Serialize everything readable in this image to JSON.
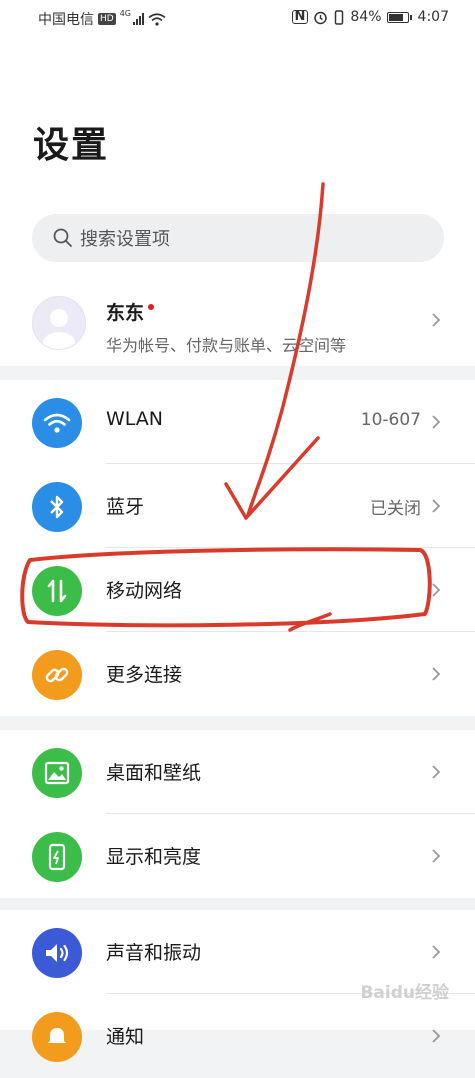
{
  "status_bar": {
    "carrier": "中国电信",
    "hd": "HD",
    "network": "4G",
    "battery": "84%",
    "battery_level": 0.84,
    "time": "4:07"
  },
  "page": {
    "title": "设置"
  },
  "search": {
    "placeholder": "搜索设置项"
  },
  "account": {
    "name": "东东",
    "subtitle": "华为帐号、付款与账单、云空间等"
  },
  "items": [
    {
      "label": "WLAN",
      "value": "10-607",
      "icon": "wifi-icon",
      "color": "#2a8de6"
    },
    {
      "label": "蓝牙",
      "value": "已关闭",
      "icon": "bluetooth-icon",
      "color": "#2a8de6"
    },
    {
      "label": "移动网络",
      "value": "",
      "icon": "mobile-data-icon",
      "color": "#3cbd4a"
    },
    {
      "label": "更多连接",
      "value": "",
      "icon": "link-icon",
      "color": "#f39b1c"
    },
    {
      "label": "桌面和壁纸",
      "value": "",
      "icon": "wallpaper-icon",
      "color": "#3cbd4a"
    },
    {
      "label": "显示和亮度",
      "value": "",
      "icon": "display-icon",
      "color": "#3cbd4a"
    },
    {
      "label": "声音和振动",
      "value": "",
      "icon": "sound-icon",
      "color": "#3d5ad6"
    },
    {
      "label": "通知",
      "value": "",
      "icon": "notification-icon",
      "color": "#f39b1c"
    }
  ],
  "watermark": "Baidu经验"
}
